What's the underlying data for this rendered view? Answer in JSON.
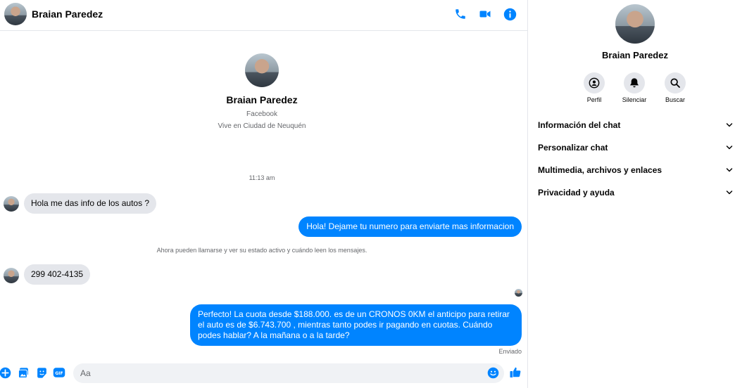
{
  "contact": {
    "name": "Braian Paredez",
    "platform": "Facebook",
    "location": "Vive en Ciudad de Neuquén"
  },
  "header": {
    "icons": [
      "phone-icon",
      "video-icon",
      "info-icon"
    ]
  },
  "conversation": {
    "timestamp": "11:13 am",
    "notice": "Ahora pueden llamarse y ver su estado activo y cuándo leen los mensajes.",
    "messages": [
      {
        "from": "contact",
        "text": "Hola me das info de los autos ?"
      },
      {
        "from": "me",
        "text": "Hola! Dejame tu numero para enviarte mas informacion"
      },
      {
        "from": "contact",
        "text": "299 402-4135"
      },
      {
        "from": "me",
        "text": "Perfecto! La cuota desde $188.000. es de un CRONOS 0KM el anticipo para retirar el auto es de $6.743.700 , mientras tanto podes ir pagando en cuotas. Cuándo podes hablar? A la mañana o a la tarde?"
      }
    ],
    "sent_status": "Enviado"
  },
  "composer": {
    "placeholder": "Aa",
    "icons": [
      "add-icon",
      "photo-icon",
      "sticker-icon",
      "gif-icon",
      "emoji-icon",
      "like-icon"
    ]
  },
  "info_panel": {
    "actions": [
      {
        "label": "Perfil",
        "icon": "profile-icon"
      },
      {
        "label": "Silenciar",
        "icon": "bell-icon"
      },
      {
        "label": "Buscar",
        "icon": "search-icon"
      }
    ],
    "sections": [
      "Información del chat",
      "Personalizar chat",
      "Multimedia, archivos y enlaces",
      "Privacidad y ayuda"
    ]
  },
  "colors": {
    "accent": "#0084ff",
    "incoming_bubble": "#e4e6eb",
    "muted_text": "#65676b"
  }
}
